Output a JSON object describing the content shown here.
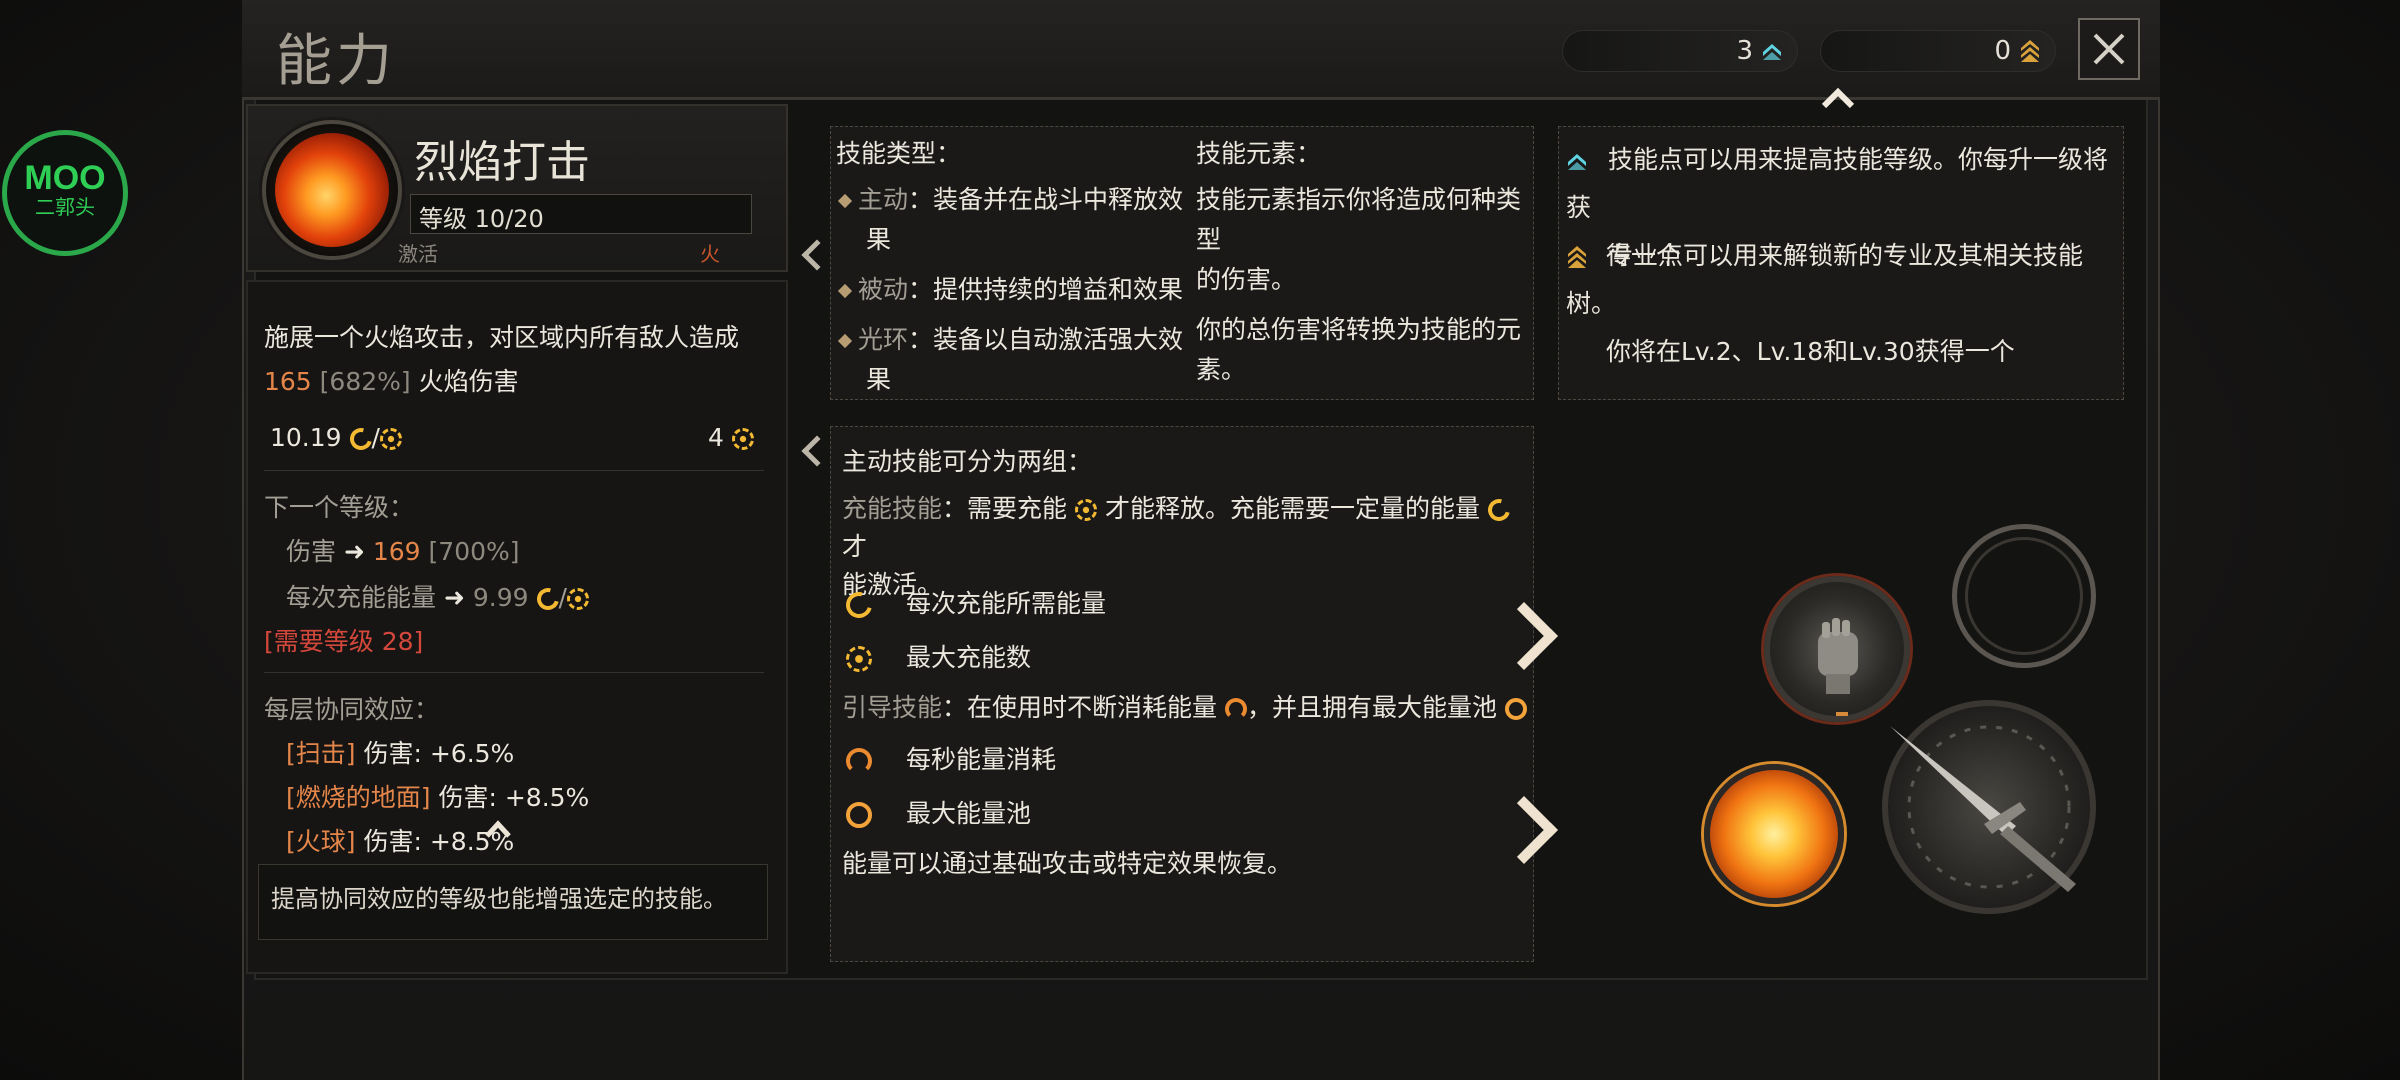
{
  "title": "能力",
  "counters": {
    "skill_points": "3",
    "specialization_points": "0"
  },
  "skill": {
    "name": "烈焰打击",
    "level": "等级 10/20",
    "tag_left": "激活",
    "tag_right": "火",
    "description_line1": "施展一个火焰攻击，对区域内所有敌人造成",
    "damage_value": "165",
    "damage_percent": "[682%]",
    "damage_suffix": "火焰伤害",
    "energy_cost": "10.19",
    "max_charges": "4",
    "next_level_label": "下一个等级：",
    "next_damage_label": "伤害",
    "next_damage_value": "169",
    "next_damage_percent": "[700%]",
    "next_energy_label": "每次充能能量",
    "next_energy_value": "9.99",
    "required_level": "[需要等级 28]",
    "synergy_label": "每层协同效应：",
    "synergy_1_name": "[扫击]",
    "synergy_1_value": "伤害: +6.5%",
    "synergy_2_name": "[燃烧的地面]",
    "synergy_2_value": "伤害: +8.5%",
    "synergy_3_name": "[火球]",
    "synergy_3_value": "伤害: +8.5%",
    "footer_tip": "提高协同效应的等级也能增强选定的技能。"
  },
  "skill_type_panel": {
    "type_title": "技能类型：",
    "active_label": "主动",
    "active_desc_1": "：装备并在战斗中释放效",
    "active_desc_2": "果",
    "passive_label": "被动",
    "passive_desc": "：提供持续的增益和效果",
    "aura_label": "光环",
    "aura_desc_1": "：装备以自动激活强大效",
    "aura_desc_2": "果",
    "element_title": "技能元素：",
    "element_desc_1": "技能元素指示你将造成何种类型",
    "element_desc_2": "的伤害。",
    "element_desc_3": "你的总伤害将转换为技能的元",
    "element_desc_4": "素。"
  },
  "active_panel": {
    "intro": "主动技能可分为两组：",
    "charge_title": "充能技能",
    "charge_desc_1": "：需要充能",
    "charge_desc_2": "才能释放。充能需要一定量的能量",
    "charge_desc_3": "才",
    "charge_desc_4": "能激活。",
    "energy_per_charge": "每次充能所需能量",
    "max_charges": "最大充能数",
    "channel_title": "引导技能",
    "channel_desc_1": "：在使用时不断消耗能量",
    "channel_desc_2": "，并且拥有最大能量池",
    "energy_per_second": "每秒能量消耗",
    "max_energy_pool": "最大能量池",
    "recover": "能量可以通过基础攻击或特定效果恢复。"
  },
  "points_panel": {
    "skill_point_1": "技能点可以用来提高技能等级。你每升一级将获",
    "skill_point_2": "得一个",
    "spec_point_1": "专业点可以用来解锁新的专业及其相关技能树。",
    "spec_point_2": "你将在Lv.2、Lv.18和Lv.30获得一个"
  },
  "watermark": {
    "top": "MOO",
    "bottom": "二郭头"
  },
  "colors": {
    "accent_orange": "#e4864a",
    "accent_yellow": "#f3b932",
    "required_red": "#d4473b",
    "skill_point_cyan": "#5fd3e0",
    "spec_point_gold": "#d9a23a"
  }
}
